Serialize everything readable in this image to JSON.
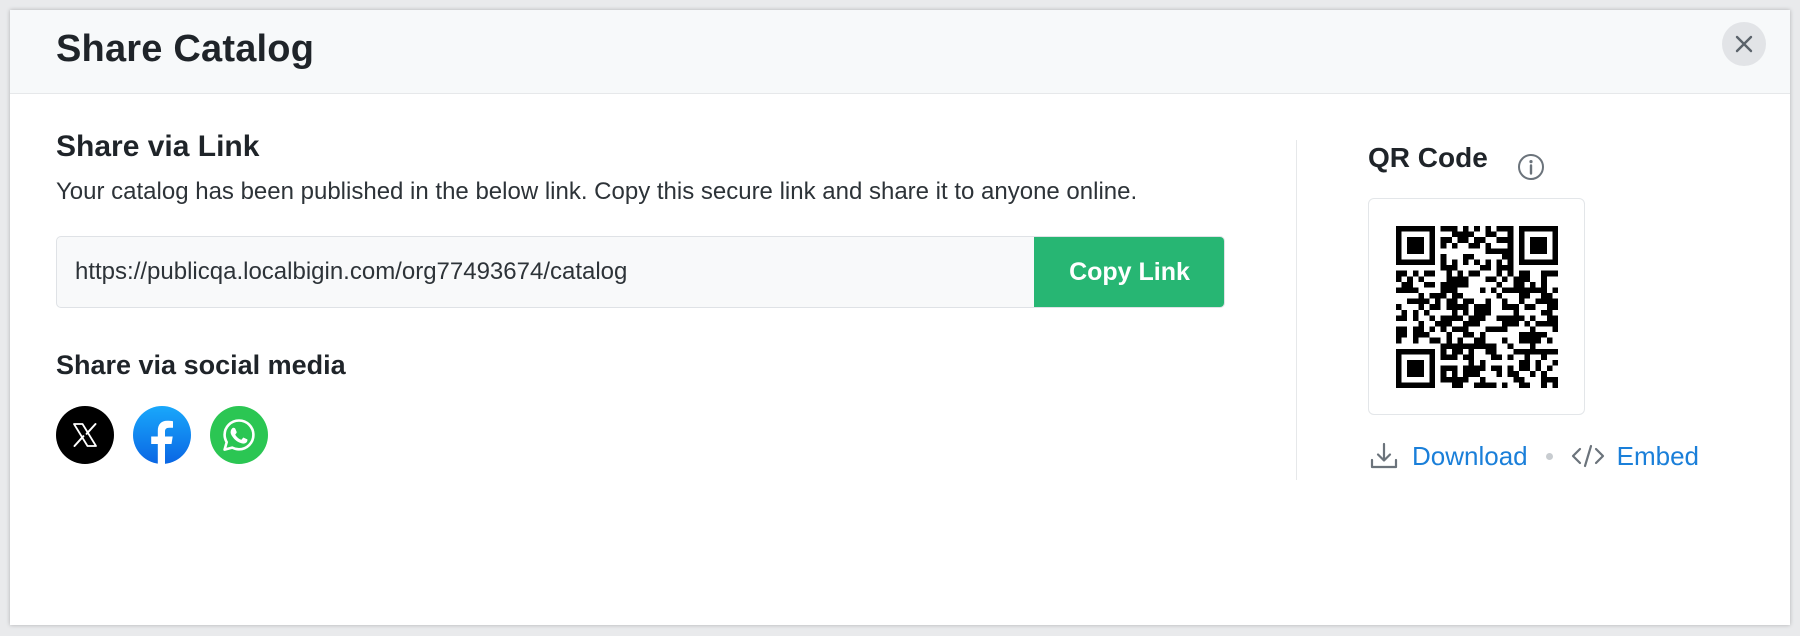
{
  "modal": {
    "title": "Share Catalog"
  },
  "share_link": {
    "heading": "Share via Link",
    "description": "Your catalog has been published in the below link. Copy this secure link and share it to anyone online.",
    "url": "https://publicqa.localbigin.com/org77493674/catalog",
    "copy_label": "Copy Link"
  },
  "social": {
    "heading": "Share via social media",
    "items": [
      {
        "name": "x",
        "icon": "x-logo-icon",
        "color": "#000000"
      },
      {
        "name": "facebook",
        "icon": "facebook-logo-icon",
        "color": "#0a66e4"
      },
      {
        "name": "whatsapp",
        "icon": "whatsapp-logo-icon",
        "color": "#2bc653"
      }
    ]
  },
  "qr": {
    "heading": "QR Code",
    "download_label": "Download",
    "embed_label": "Embed"
  },
  "colors": {
    "accent_green": "#27b673",
    "link_blue": "#1a7fd9",
    "title_text": "#1f2429"
  }
}
